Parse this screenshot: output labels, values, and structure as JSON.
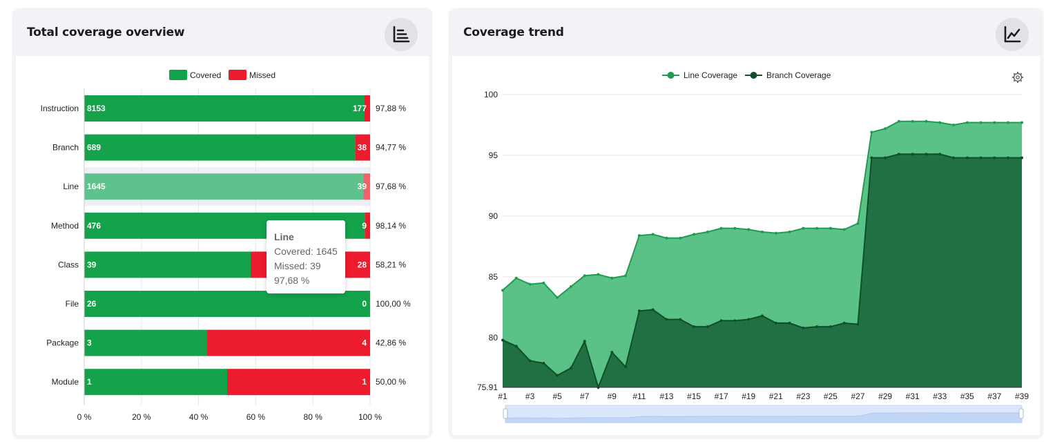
{
  "left_card": {
    "title": "Total coverage overview",
    "icon": "bar-chart-icon"
  },
  "right_card": {
    "title": "Coverage trend",
    "icon": "line-chart-icon",
    "settings_icon": "gear-icon"
  },
  "tooltip": {
    "title": "Line",
    "covered": "Covered: 1645",
    "missed": "Missed: 39",
    "percent": "97,68 %"
  },
  "colors": {
    "covered": "#14a34b",
    "missed": "#ec1b2d",
    "line_coverage": "#1d9d4e",
    "line_area": "#5ac187",
    "branch_coverage": "#0f4f27",
    "branch_area": "#217044"
  },
  "chart_data": [
    {
      "type": "bar",
      "stacked": true,
      "orientation": "horizontal",
      "title": "",
      "legend": [
        "Covered",
        "Missed"
      ],
      "legend_position": "top",
      "categories": [
        "Instruction",
        "Branch",
        "Line",
        "Method",
        "Class",
        "File",
        "Package",
        "Module"
      ],
      "series": [
        {
          "name": "Covered",
          "values": [
            8153,
            689,
            1645,
            476,
            39,
            26,
            3,
            1
          ]
        },
        {
          "name": "Missed",
          "values": [
            177,
            38,
            39,
            9,
            28,
            0,
            4,
            1
          ]
        }
      ],
      "percent_labels": [
        "97,88 %",
        "94,77 %",
        "97,68 %",
        "98,14 %",
        "58,21 %",
        "100,00 %",
        "42,86 %",
        "50,00 %"
      ],
      "x_ticks": [
        "0 %",
        "20 %",
        "40 %",
        "60 %",
        "80 %",
        "100 %"
      ],
      "xlim": [
        0,
        100
      ],
      "highlighted_category": "Line",
      "grid": true
    },
    {
      "type": "area",
      "title": "",
      "legend": [
        "Line Coverage",
        "Branch Coverage"
      ],
      "legend_position": "top",
      "x": [
        "#1",
        "#2",
        "#3",
        "#4",
        "#5",
        "#6",
        "#7",
        "#8",
        "#9",
        "#10",
        "#11",
        "#12",
        "#13",
        "#14",
        "#15",
        "#16",
        "#17",
        "#18",
        "#19",
        "#20",
        "#21",
        "#22",
        "#23",
        "#24",
        "#25",
        "#26",
        "#27",
        "#28",
        "#29",
        "#30",
        "#31",
        "#32",
        "#33",
        "#34",
        "#35",
        "#36",
        "#37",
        "#38",
        "#39"
      ],
      "x_tick_labels": [
        "#1",
        "#3",
        "#5",
        "#7",
        "#9",
        "#11",
        "#13",
        "#15",
        "#17",
        "#19",
        "#21",
        "#23",
        "#25",
        "#27",
        "#29",
        "#31",
        "#33",
        "#35",
        "#37",
        "#39"
      ],
      "series": [
        {
          "name": "Line Coverage",
          "values": [
            83.9,
            84.9,
            84.4,
            84.5,
            83.3,
            84.2,
            85.1,
            85.2,
            84.9,
            85.1,
            88.4,
            88.5,
            88.2,
            88.2,
            88.5,
            88.7,
            89.0,
            89.0,
            88.9,
            88.7,
            88.6,
            88.7,
            89.0,
            89.0,
            89.0,
            88.9,
            89.4,
            96.9,
            97.2,
            97.8,
            97.8,
            97.8,
            97.7,
            97.5,
            97.7,
            97.7,
            97.7,
            97.7,
            97.7
          ]
        },
        {
          "name": "Branch Coverage",
          "values": [
            79.8,
            79.3,
            78.1,
            77.9,
            76.9,
            77.5,
            79.7,
            75.91,
            78.8,
            77.6,
            82.2,
            82.3,
            81.5,
            81.5,
            80.9,
            80.9,
            81.4,
            81.4,
            81.5,
            81.8,
            81.2,
            81.2,
            80.8,
            80.9,
            80.9,
            81.2,
            81.1,
            94.8,
            94.8,
            95.1,
            95.1,
            95.1,
            95.1,
            94.8,
            94.8,
            94.8,
            94.8,
            94.8,
            94.8
          ]
        }
      ],
      "y_ticks": [
        "100",
        "95",
        "90",
        "85",
        "80",
        "75.91"
      ],
      "ylim": [
        75.91,
        100
      ],
      "grid": true
    }
  ]
}
